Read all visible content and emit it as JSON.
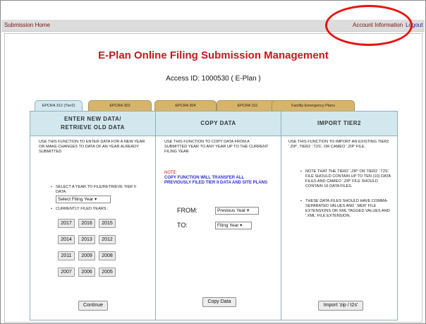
{
  "topbar": {
    "home": "Submission Home",
    "account": "Account Information",
    "logout": "Logout"
  },
  "header": {
    "title": "E-Plan Online Filing Submission Management",
    "access_id": "Access ID: 1000530 ( E-Plan )"
  },
  "tabs": [
    {
      "label": "EPCRA 312 (Tier2)"
    },
    {
      "label": "EPCRA 302"
    },
    {
      "label": "EPCRA 304"
    },
    {
      "label": "EPCRA 311"
    },
    {
      "label": "Facility Emergency Plans"
    }
  ],
  "enter": {
    "heading1": "ENTER NEW DATA/",
    "heading2": "RETRIEVE OLD DATA",
    "desc": "Use this function to enter data for a new year or make changes to data of an year already submitted",
    "select_prompt": "Select a year to file/retrieve Tier II data:",
    "select_value": "Select Filing Year",
    "filed_label": "Currently filed years :",
    "years": [
      "2017",
      "2016",
      "2015",
      "2014",
      "2013",
      "2012",
      "2011",
      "2009",
      "2008",
      "2007",
      "2006",
      "2005"
    ],
    "continue": "Continue"
  },
  "copy": {
    "heading": "COPY DATA",
    "desc": "Use this function to copy data from a submitted year to any year up to the current filing year",
    "note_label": "NOTE:",
    "note_body": "Copy function will transfer all previously filed Tier II data and site plans",
    "from_label": "FROM:",
    "from_value": "Previous Year",
    "to_label": "TO:",
    "to_value": "Filing Year",
    "button": "Copy Data"
  },
  "import": {
    "heading": "IMPORT TIER2",
    "desc": "Use this function to import an existing Tier2 '.ZIP', Tier2 '.T2S', or Cameo '.ZIP' file.",
    "bullet1": "Note that the Tier2 '.ZIP' or Tier2 '.T2S' file should contain up to ten (10) data files and Cameo '.ZIP' file should contain 16 data files.",
    "bullet2": "These data files should have comma-separated values and '.mer' file extensions or XML tagged values and '.xml' file extension.",
    "button": "Import 'zip / t2s'"
  },
  "colors": {
    "title": "#c8171d",
    "tab_active": "#d3e9ef",
    "tab_inactive": "#d8b46a",
    "annotation": "#e8120c"
  }
}
